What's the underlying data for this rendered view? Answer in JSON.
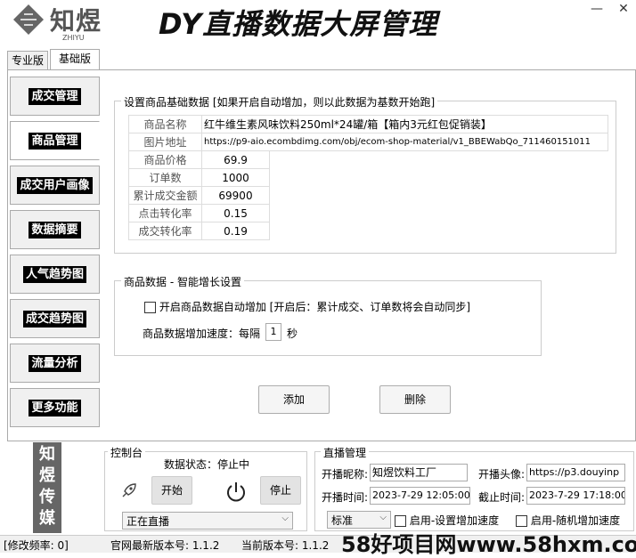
{
  "header": {
    "logo_text": "知煜",
    "logo_sub": "ZHIYU",
    "title": "DY直播数据大屏管理",
    "minimize": "—",
    "close": "✕"
  },
  "tabs": [
    "专业版",
    "基础版"
  ],
  "sidebar": [
    "成交管理",
    "商品管理",
    "成交用户画像",
    "数据摘要",
    "人气趋势图",
    "成交趋势图",
    "流量分析",
    "更多功能"
  ],
  "product_settings": {
    "group_title": "设置商品基础数据 [如果开启自动增加，则以此数据为基数开始跑]",
    "fields": [
      {
        "label": "商品名称",
        "value": "红牛维生素风味饮料250ml*24罐/箱【箱内3元红包促销装】"
      },
      {
        "label": "图片地址",
        "value": "https://p9-aio.ecombdimg.com/obj/ecom-shop-material/v1_BBEWabQo_711460151011"
      },
      {
        "label": "商品价格",
        "value": "69.9"
      },
      {
        "label": "订单数",
        "value": "1000"
      },
      {
        "label": "累计成交金额",
        "value": "69900"
      },
      {
        "label": "点击转化率",
        "value": "0.15"
      },
      {
        "label": "成交转化率",
        "value": "0.19"
      }
    ]
  },
  "smart_growth": {
    "group_title": "商品数据 - 智能增长设置",
    "checkbox_label": "开启商品数据自动增加  [开启后：累计成交、订单数将会自动同步]",
    "speed_prefix": "商品数据增加速度：每隔",
    "speed_value": "1",
    "speed_suffix": "秒"
  },
  "actions": {
    "add": "添加",
    "delete": "删除"
  },
  "banner": [
    "知",
    "煜",
    "传",
    "媒"
  ],
  "console": {
    "title": "控制台",
    "status": "数据状态：停止中",
    "start": "开始",
    "stop": "停止",
    "mode": "正在直播"
  },
  "live": {
    "title": "直播管理",
    "nick_label": "开播昵称:",
    "nick_value": "知煜饮料工厂",
    "avatar_label": "开播头像:",
    "avatar_value": "https://p3.douyinp",
    "start_label": "开播时间:",
    "start_value": "2023-7-29 12:05:00",
    "end_label": "截止时间:",
    "end_value": "2023-7-29 17:18:00",
    "std": "标准",
    "cb1": "启用-设置增加速度",
    "cb2": "启用-随机增加速度"
  },
  "statusbar": {
    "freq": "[修改频率: 0]",
    "latest": "官网最新版本号: 1.1.2",
    "current": "当前版本号: 1.1.2"
  },
  "watermark": "58好项目网www.58hxm.com"
}
